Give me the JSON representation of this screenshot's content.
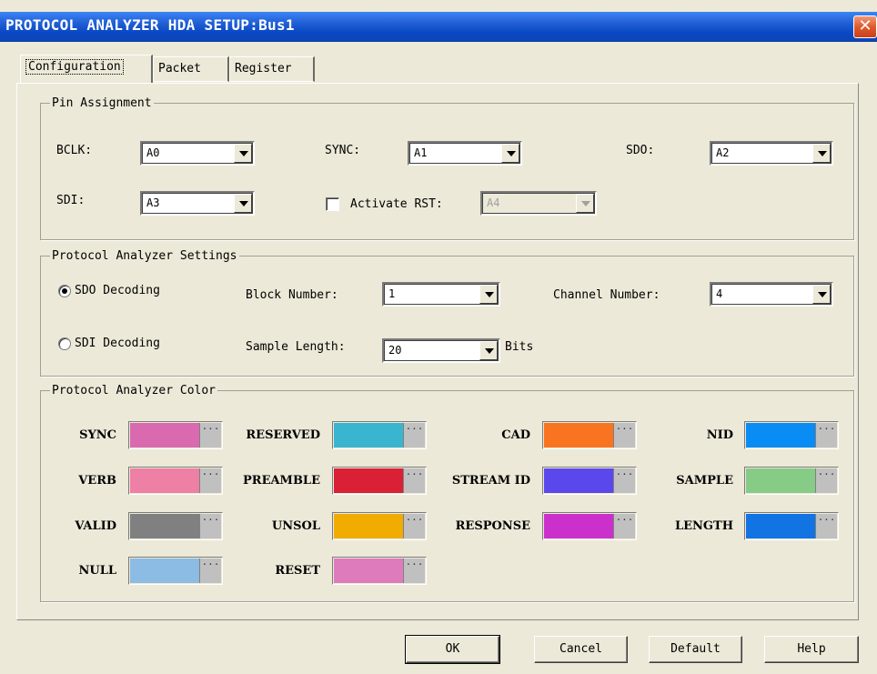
{
  "window": {
    "title": "PROTOCOL ANALYZER HDA SETUP:Bus1",
    "close_glyph": "✕"
  },
  "tabs": [
    {
      "label": "Configuration"
    },
    {
      "label": "Packet"
    },
    {
      "label": "Register"
    }
  ],
  "pin_assignment": {
    "legend": "Pin Assignment",
    "bclk": {
      "label": "BCLK:",
      "value": "A0"
    },
    "sync": {
      "label": "SYNC:",
      "value": "A1"
    },
    "sdo": {
      "label": "SDO:",
      "value": "A2"
    },
    "sdi": {
      "label": "SDI:",
      "value": "A3"
    },
    "rst": {
      "label": "Activate RST:",
      "value": "A4",
      "checked": false
    }
  },
  "settings": {
    "legend": "Protocol Analyzer Settings",
    "sdo_decoding": "SDO Decoding",
    "sdi_decoding": "SDI Decoding",
    "selected_decoding": "SDO Decoding",
    "block_number": {
      "label": "Block Number:",
      "value": "1"
    },
    "channel_number": {
      "label": "Channel Number:",
      "value": "4"
    },
    "sample_length": {
      "label": "Sample Length:",
      "value": "20",
      "unit": "Bits"
    }
  },
  "colors": {
    "legend": "Protocol Analyzer Color",
    "dots": "···",
    "items": [
      {
        "label": "SYNC",
        "color": "#d96aaf"
      },
      {
        "label": "RESERVED",
        "color": "#3ab5d0"
      },
      {
        "label": "CAD",
        "color": "#f97420"
      },
      {
        "label": "NID",
        "color": "#0a8cf5"
      },
      {
        "label": "VERB",
        "color": "#ee7fa5"
      },
      {
        "label": "PREAMBLE",
        "color": "#d92035"
      },
      {
        "label": "STREAM ID",
        "color": "#5b48ec"
      },
      {
        "label": "SAMPLE",
        "color": "#86cc86"
      },
      {
        "label": "VALID",
        "color": "#808080"
      },
      {
        "label": "UNSOL",
        "color": "#f0ac00"
      },
      {
        "label": "RESPONSE",
        "color": "#cc30cc"
      },
      {
        "label": "LENGTH",
        "color": "#1273e3"
      },
      {
        "label": "NULL",
        "color": "#8cbce3"
      },
      {
        "label": "RESET",
        "color": "#de7bbd"
      }
    ]
  },
  "buttons": {
    "ok": "OK",
    "cancel": "Cancel",
    "default": "Default",
    "help": "Help"
  }
}
